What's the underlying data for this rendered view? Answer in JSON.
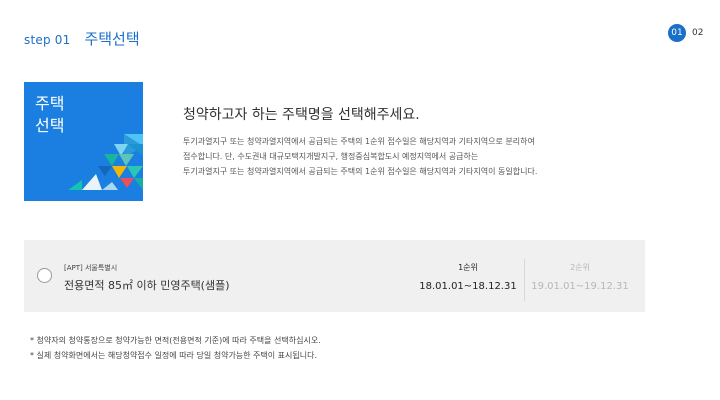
{
  "header": {
    "step_label": "step 01",
    "step_title": "주택선택"
  },
  "step_nav": {
    "current": "01",
    "next": "02"
  },
  "hero": {
    "line1": "주택",
    "line2": "선택"
  },
  "intro": {
    "title": "청약하고자 하는 주택명을 선택해주세요.",
    "body_lines": [
      "투기과열지구 또는 청약과열지역에서 공급되는 주택의 1순위 접수일은 해당지역과 기타지역으로 분리하여",
      "접수합니다. 단, 수도권내 대규모택지개발지구, 행정중심복합도시 예정지역에서 공급하는",
      "투기과열지구 또는 청약과열지역에서 공급되는 주택의 1순위 접수일은 해당지역과 기타지역이 동일합니다."
    ]
  },
  "housing_option": {
    "tag": "[APT] 서울특별시",
    "title": "전용면적 85㎡ 이하 민영주택(샘플)",
    "rank1": {
      "label": "1순위",
      "dates": "18.01.01~18.12.31"
    },
    "rank2": {
      "label": "2순위",
      "dates": "19.01.01~19.12.31"
    }
  },
  "notes": [
    "* 청약자의 청약통장으로 청약가능한 면적(전용면적 기준)에 따라 주택을 선택하십시오.",
    "* 실제 청약화면에서는 해당청약접수 일정에 따라 당일 청약가능한 주택이 표시됩니다."
  ],
  "colors": {
    "accent": "#1a6fc9",
    "tile": "#1a7fe0",
    "panel": "#f0f0f0"
  },
  "icons": {
    "selection": "radio-button"
  }
}
